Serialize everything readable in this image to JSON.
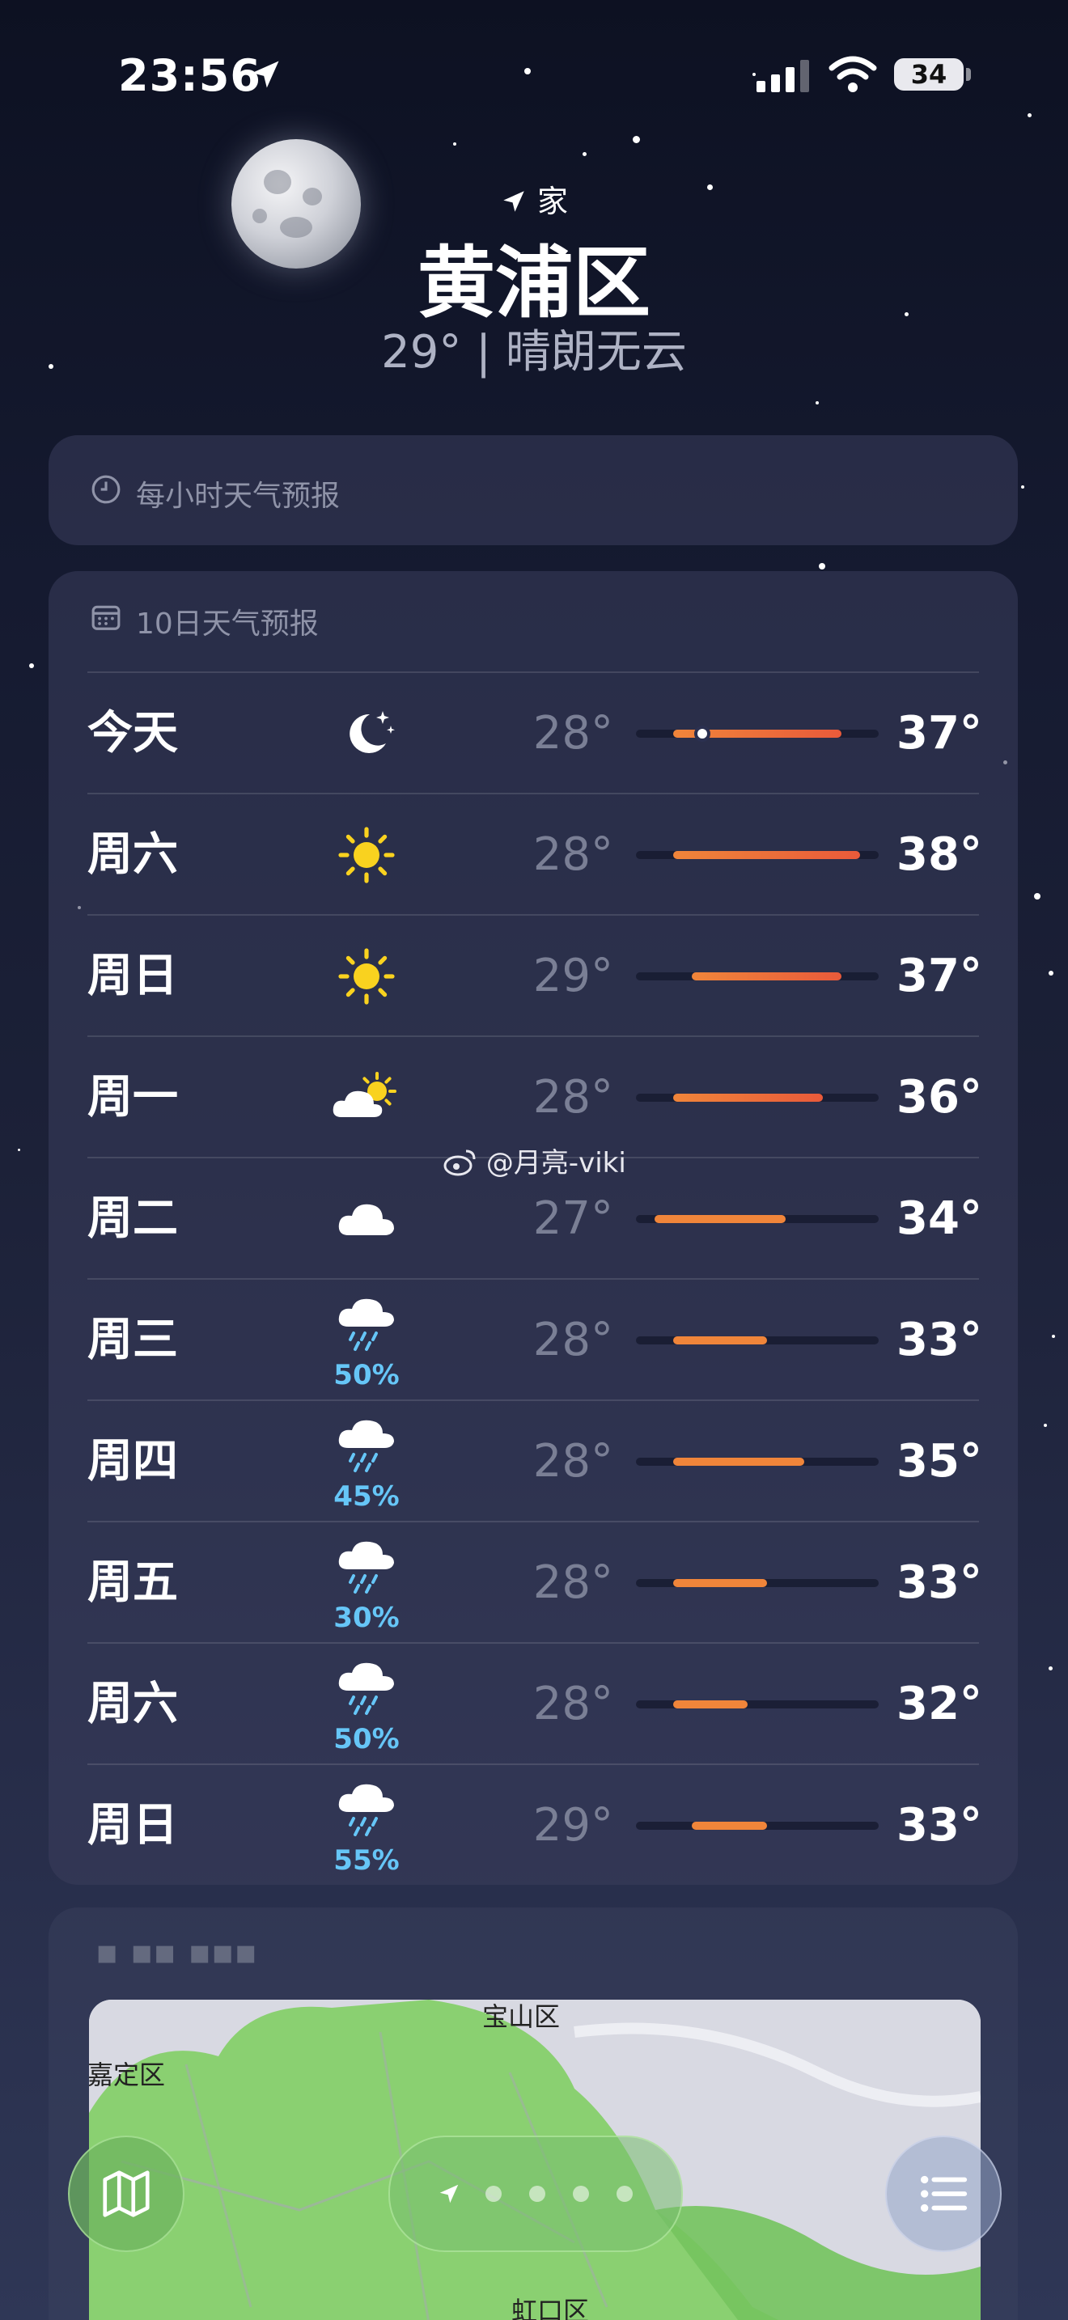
{
  "status_bar": {
    "time": "23:56",
    "battery": "34"
  },
  "header": {
    "home_label": "家",
    "city": "黄浦区",
    "summary": "29° | 晴朗无云"
  },
  "hourly_card": {
    "title": "每小时天气预报"
  },
  "forecast_card": {
    "title": "10日天气预报",
    "days": [
      {
        "day": "今天",
        "icon": "moon-stars-icon",
        "precip": "",
        "low": "28°",
        "high": "37°"
      },
      {
        "day": "周六",
        "icon": "sun-icon",
        "precip": "",
        "low": "28°",
        "high": "38°"
      },
      {
        "day": "周日",
        "icon": "sun-icon",
        "precip": "",
        "low": "29°",
        "high": "37°"
      },
      {
        "day": "周一",
        "icon": "partly-cloudy-icon",
        "precip": "",
        "low": "28°",
        "high": "36°"
      },
      {
        "day": "周二",
        "icon": "cloud-icon",
        "precip": "",
        "low": "27°",
        "high": "34°"
      },
      {
        "day": "周三",
        "icon": "rain-icon",
        "precip": "50%",
        "low": "28°",
        "high": "33°"
      },
      {
        "day": "周四",
        "icon": "rain-icon",
        "precip": "45%",
        "low": "28°",
        "high": "35°"
      },
      {
        "day": "周五",
        "icon": "rain-icon",
        "precip": "30%",
        "low": "28°",
        "high": "33°"
      },
      {
        "day": "周六",
        "icon": "rain-icon",
        "precip": "50%",
        "low": "28°",
        "high": "32°"
      },
      {
        "day": "周日",
        "icon": "rain-icon",
        "precip": "55%",
        "low": "29°",
        "high": "33°"
      }
    ]
  },
  "watermark": "@月亮-viki",
  "map": {
    "labels": [
      "宝山区",
      "嘉定区",
      "虹口区"
    ]
  },
  "colors": {
    "bar_warm": "#f0853a",
    "bar_hot": "#e95a3a",
    "precip": "#66c6f7"
  }
}
